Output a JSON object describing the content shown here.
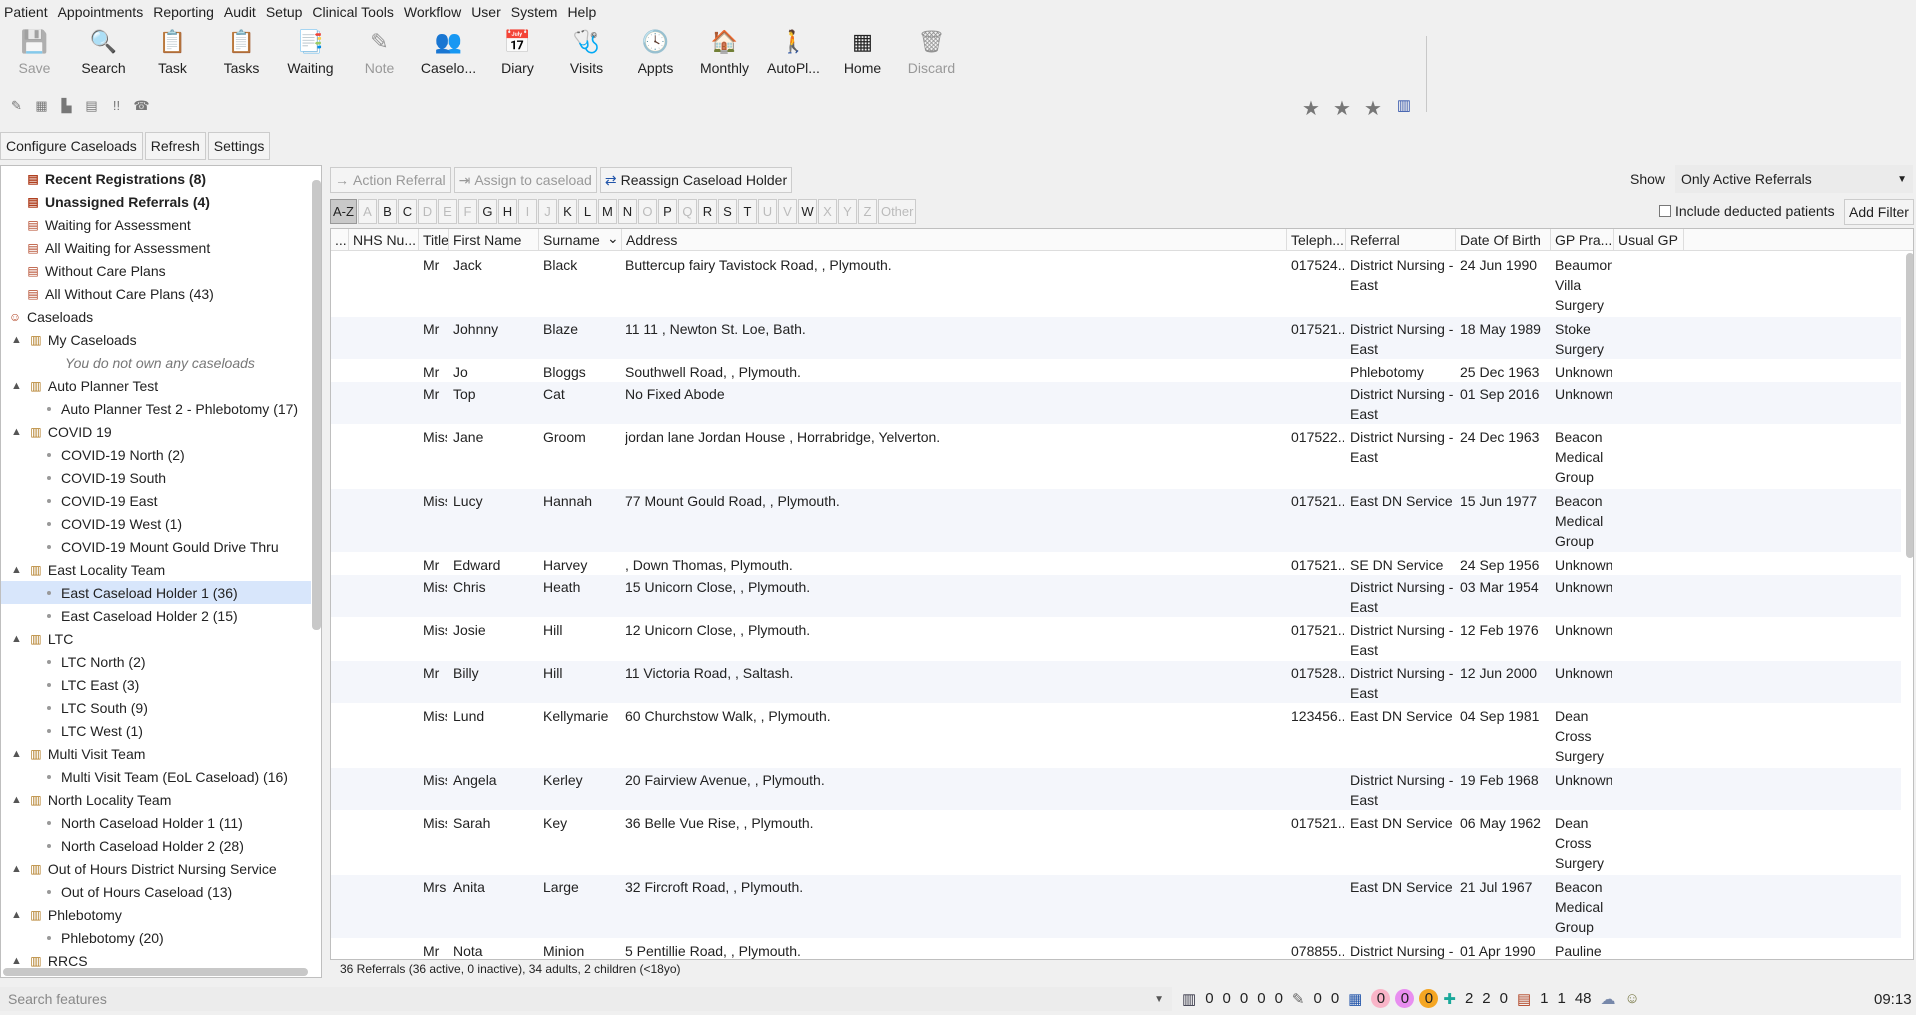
{
  "menu": [
    "Patient",
    "Appointments",
    "Reporting",
    "Audit",
    "Setup",
    "Clinical Tools",
    "Workflow",
    "User",
    "System",
    "Help"
  ],
  "toolbar": [
    {
      "label": "Save",
      "icon": "save-icon",
      "disabled": true
    },
    {
      "label": "Search",
      "icon": "search-icon",
      "disabled": false
    },
    {
      "label": "Task",
      "icon": "task-icon",
      "disabled": false
    },
    {
      "label": "Tasks",
      "icon": "tasks-icon",
      "disabled": false
    },
    {
      "label": "Waiting",
      "icon": "waiting-icon",
      "disabled": false
    },
    {
      "label": "Note",
      "icon": "note-icon",
      "disabled": true
    },
    {
      "label": "Caselo...",
      "icon": "caseload-icon",
      "disabled": false
    },
    {
      "label": "Diary",
      "icon": "diary-icon",
      "disabled": false
    },
    {
      "label": "Visits",
      "icon": "visits-icon",
      "disabled": false
    },
    {
      "label": "Appts",
      "icon": "appts-icon",
      "disabled": false
    },
    {
      "label": "Monthly",
      "icon": "monthly-icon",
      "disabled": false
    },
    {
      "label": "AutoPl...",
      "icon": "autoplanner-icon",
      "disabled": false
    },
    {
      "label": "Home",
      "icon": "home-icon",
      "disabled": false
    },
    {
      "label": "Discard",
      "icon": "discard-icon",
      "disabled": true
    }
  ],
  "caseload_buttons": {
    "configure": "Configure Caseloads",
    "refresh": "Refresh",
    "settings": "Settings"
  },
  "tree": [
    {
      "label": "Recent Registrations (8)",
      "bold": true,
      "level": 1
    },
    {
      "label": "Unassigned Referrals (4)",
      "bold": true,
      "level": 1
    },
    {
      "label": "Waiting for Assessment",
      "level": 1
    },
    {
      "label": "All Waiting for Assessment",
      "level": 1
    },
    {
      "label": "Without Care Plans",
      "level": 1
    },
    {
      "label": "All Without Care Plans (43)",
      "level": 1
    },
    {
      "label": "Caseloads",
      "level": 0
    },
    {
      "label": "My Caseloads",
      "level": 1,
      "group": true
    },
    {
      "label": "You do not own any caseloads",
      "level": 2,
      "italic": true
    },
    {
      "label": "Auto Planner Test",
      "level": 1,
      "group": true
    },
    {
      "label": "Auto Planner Test 2 - Phlebotomy (17)",
      "level": 2
    },
    {
      "label": "COVID 19",
      "level": 1,
      "group": true
    },
    {
      "label": "COVID-19 North (2)",
      "level": 2
    },
    {
      "label": "COVID-19 South",
      "level": 2
    },
    {
      "label": "COVID-19 East",
      "level": 2
    },
    {
      "label": "COVID-19 West (1)",
      "level": 2
    },
    {
      "label": "COVID-19 Mount Gould Drive Thru",
      "level": 2
    },
    {
      "label": "East Locality Team",
      "level": 1,
      "group": true
    },
    {
      "label": "East Caseload Holder 1 (36)",
      "level": 2,
      "selected": true
    },
    {
      "label": "East Caseload Holder 2 (15)",
      "level": 2
    },
    {
      "label": "LTC",
      "level": 1,
      "group": true
    },
    {
      "label": "LTC North (2)",
      "level": 2
    },
    {
      "label": "LTC East (3)",
      "level": 2
    },
    {
      "label": "LTC South (9)",
      "level": 2
    },
    {
      "label": "LTC West (1)",
      "level": 2
    },
    {
      "label": "Multi Visit Team",
      "level": 1,
      "group": true
    },
    {
      "label": "Multi Visit Team  (EoL Caseload) (16)",
      "level": 2
    },
    {
      "label": "North Locality Team",
      "level": 1,
      "group": true
    },
    {
      "label": "North Caseload Holder 1 (11)",
      "level": 2
    },
    {
      "label": "North Caseload Holder 2 (28)",
      "level": 2
    },
    {
      "label": "Out of Hours District Nursing Service",
      "level": 1,
      "group": true
    },
    {
      "label": "Out of Hours Caseload (13)",
      "level": 2
    },
    {
      "label": "Phlebotomy",
      "level": 1,
      "group": true
    },
    {
      "label": "Phlebotomy (20)",
      "level": 2
    },
    {
      "label": "RRCS",
      "level": 1,
      "group": true
    }
  ],
  "actions": {
    "action_referral": "Action Referral",
    "assign": "Assign to caseload",
    "reassign": "Reassign Caseload Holder"
  },
  "show": {
    "label": "Show",
    "value": "Only Active Referrals"
  },
  "az": [
    "A-Z",
    "A",
    "B",
    "C",
    "D",
    "E",
    "F",
    "G",
    "H",
    "I",
    "J",
    "K",
    "L",
    "M",
    "N",
    "O",
    "P",
    "Q",
    "R",
    "S",
    "T",
    "U",
    "V",
    "W",
    "X",
    "Y",
    "Z",
    "Other"
  ],
  "az_disabled": [
    "A",
    "D",
    "E",
    "F",
    "I",
    "J",
    "O",
    "Q",
    "U",
    "V",
    "X",
    "Y",
    "Z",
    "Other"
  ],
  "include_deducted": "Include deducted patients",
  "add_filter": "Add Filter",
  "columns": [
    "...",
    "NHS Nu...",
    "Title",
    "First Name",
    "Surname",
    "Address",
    "Teleph...",
    "Referral",
    "Date Of Birth",
    "GP Pra...",
    "Usual GP"
  ],
  "rows": [
    {
      "title": "Mr",
      "first": "Jack",
      "surname": "Black",
      "address": " Buttercup fairy Tavistock Road, , Plymouth.",
      "tel": "017524...",
      "referral": "District Nursing - East",
      "dob": "24 Jun 1990",
      "gp": "Beaumon Villa Surgery",
      "lines": 3
    },
    {
      "title": "Mr",
      "first": "Johnny",
      "surname": "Blaze",
      "address": "11 11  , Newton St. Loe, Bath.",
      "tel": "017521...",
      "referral": "District Nursing - East",
      "dob": "18 May 1989",
      "gp": "Stoke Surgery",
      "lines": 2
    },
    {
      "title": "Mr",
      "first": "Jo",
      "surname": "Bloggs",
      "address": "  Southwell Road, , Plymouth.",
      "tel": "",
      "referral": "Phlebotomy",
      "dob": "25 Dec 1963",
      "gp": "Unknown",
      "lines": 1
    },
    {
      "title": "Mr",
      "first": "Top",
      "surname": "Cat",
      "address": "No Fixed Abode",
      "tel": "",
      "referral": "District Nursing - East",
      "dob": "01 Sep 2016",
      "gp": "Unknown",
      "lines": 2
    },
    {
      "title": "Miss",
      "first": "Jane",
      "surname": "Groom",
      "address": "jordan lane Jordan House  , Horrabridge, Yelverton.",
      "tel": "017522...",
      "referral": "District Nursing - East",
      "dob": "24 Dec 1963",
      "gp": "Beacon Medical Group",
      "lines": 3
    },
    {
      "title": "Miss",
      "first": "Lucy",
      "surname": "Hannah",
      "address": "77  Mount Gould Road, , Plymouth.",
      "tel": "017521...",
      "referral": "East DN Service",
      "dob": "15 Jun 1977",
      "gp": "Beacon Medical Group",
      "lines": 3
    },
    {
      "title": "Mr",
      "first": "Edward",
      "surname": "Harvey",
      "address": "    , Down Thomas, Plymouth.",
      "tel": "017521...",
      "referral": "SE DN Service",
      "dob": "24 Sep 1956",
      "gp": "Unknown",
      "lines": 1
    },
    {
      "title": "Miss",
      "first": "Chris",
      "surname": "Heath",
      "address": "15  Unicorn Close, , Plymouth.",
      "tel": "",
      "referral": "District Nursing - East",
      "dob": "03 Mar 1954",
      "gp": "Unknown",
      "lines": 2
    },
    {
      "title": "Miss",
      "first": "Josie",
      "surname": "Hill",
      "address": "12  Unicorn Close, , Plymouth.",
      "tel": "017521...",
      "referral": "District Nursing - East",
      "dob": "12 Feb 1976",
      "gp": "Unknown",
      "lines": 2
    },
    {
      "title": "Mr",
      "first": "Billy",
      "surname": "Hill",
      "address": "11  Victoria Road, , Saltash.",
      "tel": "017528...",
      "referral": "District Nursing - East",
      "dob": "12 Jun 2000",
      "gp": "Unknown",
      "lines": 2
    },
    {
      "title": "Miss",
      "first": "Lund",
      "surname": "Kellymarie",
      "address": " 60 Churchstow Walk, , Plymouth.",
      "tel": "123456...",
      "referral": "East DN Service",
      "dob": "04 Sep 1981",
      "gp": "Dean Cross Surgery",
      "lines": 3
    },
    {
      "title": "Miss",
      "first": "Angela",
      "surname": "Kerley",
      "address": "20  Fairview Avenue, , Plymouth.",
      "tel": "",
      "referral": "District Nursing - East",
      "dob": "19 Feb 1968",
      "gp": "Unknown",
      "lines": 2
    },
    {
      "title": "Miss",
      "first": "Sarah",
      "surname": "Key",
      "address": "36  Belle Vue Rise, , Plymouth.",
      "tel": "017521...",
      "referral": "East DN Service",
      "dob": "06 May 1962",
      "gp": "Dean Cross Surgery",
      "lines": 3
    },
    {
      "title": "Mrs",
      "first": "Anita",
      "surname": "Large",
      "address": "32  Fircroft Road, , Plymouth.",
      "tel": "",
      "referral": "East DN Service",
      "dob": "21 Jul 1967",
      "gp": "Beacon Medical Group",
      "lines": 3
    },
    {
      "title": "Mr",
      "first": "Nota",
      "surname": "Minion",
      "address": "5  Pentillie Road, , Plymouth.",
      "tel": "078855...",
      "referral": "District Nursing - South",
      "dob": "01 Apr 1990",
      "gp": "Pauline Porters",
      "lines": 2
    }
  ],
  "summary": "36 Referrals (36 active, 0 inactive), 34 adults, 2 children (<18yo)",
  "status": {
    "search_placeholder": "Search features",
    "counters_a": [
      "0",
      "0",
      "0",
      "0",
      "0"
    ],
    "counters_b": [
      "0",
      "0"
    ],
    "counters_c": [
      "0",
      "0",
      "0"
    ],
    "counters_d": [
      "2",
      "2",
      "0"
    ],
    "counters_e": [
      "1",
      "1",
      "48"
    ],
    "clock": "09:13"
  }
}
